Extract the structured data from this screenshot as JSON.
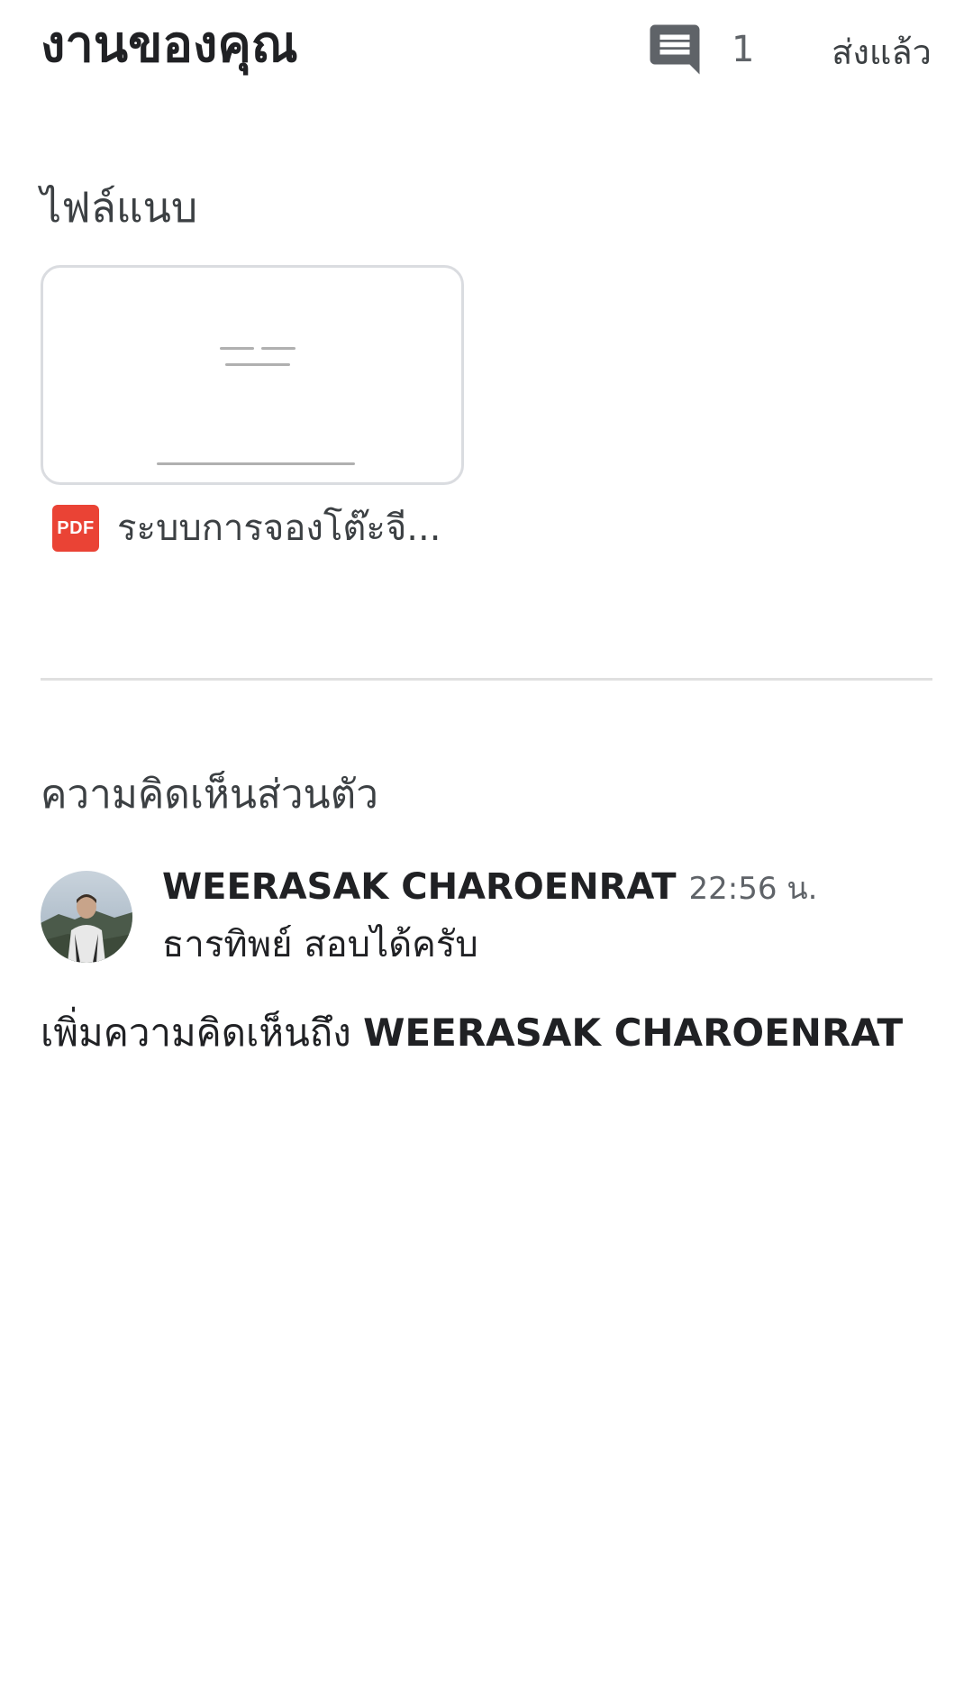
{
  "header": {
    "title": "งานของคุณ",
    "comment_count": "1",
    "status": "ส่งแล้ว"
  },
  "attachments": {
    "section_title": "ไฟล์แนบ",
    "items": [
      {
        "name": "ระบบการจองโต๊ะจี...",
        "type_badge": "PDF",
        "type_color": "#ea4335"
      }
    ]
  },
  "private_comments": {
    "section_title": "ความคิดเห็นส่วนตัว",
    "comments": [
      {
        "author": "WEERASAK CHAROENRAT",
        "time": "22:56 น.",
        "text": "ธารทิพย์ สอบได้ครับ"
      }
    ],
    "add_prompt": "เพิ่มความคิดเห็นถึง",
    "add_prompt_recipient": "WEERASAK CHAROENRAT"
  }
}
